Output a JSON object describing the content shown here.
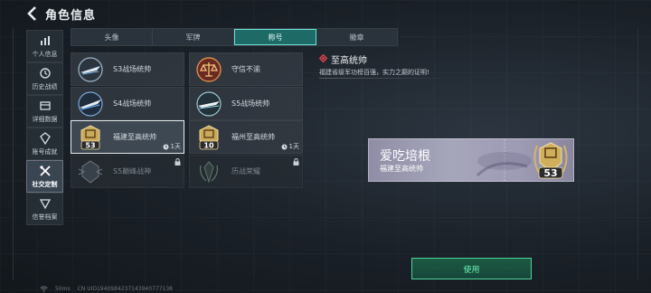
{
  "header": {
    "title": "角色信息"
  },
  "sidebar": {
    "items": [
      {
        "label": "个人信息",
        "icon": "bar-chart-icon"
      },
      {
        "label": "历史战绩",
        "icon": "history-icon"
      },
      {
        "label": "详细数据",
        "icon": "data-icon"
      },
      {
        "label": "账号成就",
        "icon": "achievement-icon"
      },
      {
        "label": "社交定制",
        "icon": "tools-icon",
        "active": true
      },
      {
        "label": "信誉档案",
        "icon": "reputation-icon"
      }
    ]
  },
  "tabs": [
    {
      "label": "头像"
    },
    {
      "label": "军牌"
    },
    {
      "label": "称号",
      "active": true
    },
    {
      "label": "徽章"
    }
  ],
  "titles": [
    {
      "name": "S3战场统帅",
      "emblem": "jet-emblem-icon"
    },
    {
      "name": "守信不渝",
      "emblem": "scales-emblem-icon"
    },
    {
      "name": "S4战场统帅",
      "emblem": "jet-emblem-icon"
    },
    {
      "name": "S5战场统帅",
      "emblem": "jet-emblem-icon"
    },
    {
      "name": "福建至高统帅",
      "emblem": "gold-badge-icon",
      "badge": "53",
      "duration": "1天",
      "selected": true
    },
    {
      "name": "福州至高统帅",
      "emblem": "gold-badge-icon",
      "badge": "10",
      "duration": "1天"
    },
    {
      "name": "S5巅峰战神",
      "emblem": "silver-emblem-icon",
      "locked": true
    },
    {
      "name": "历战荣耀",
      "emblem": "wreath-emblem-icon",
      "locked": true
    }
  ],
  "detail": {
    "title": "至高统帅",
    "description": "福建省级军功榜百强，实力之巅的证明!"
  },
  "nameplate": {
    "player_name": "爱吃培根",
    "title_text": "福建至高统帅",
    "badge_number": "53"
  },
  "actions": {
    "use_label": "使用"
  },
  "footer": {
    "ping": "50ms",
    "uid": "CN UID1940984237143940777138"
  },
  "colors": {
    "accent": "#4fd29a",
    "tab_active": "#1d6a66",
    "diamond": "#e0474c"
  }
}
